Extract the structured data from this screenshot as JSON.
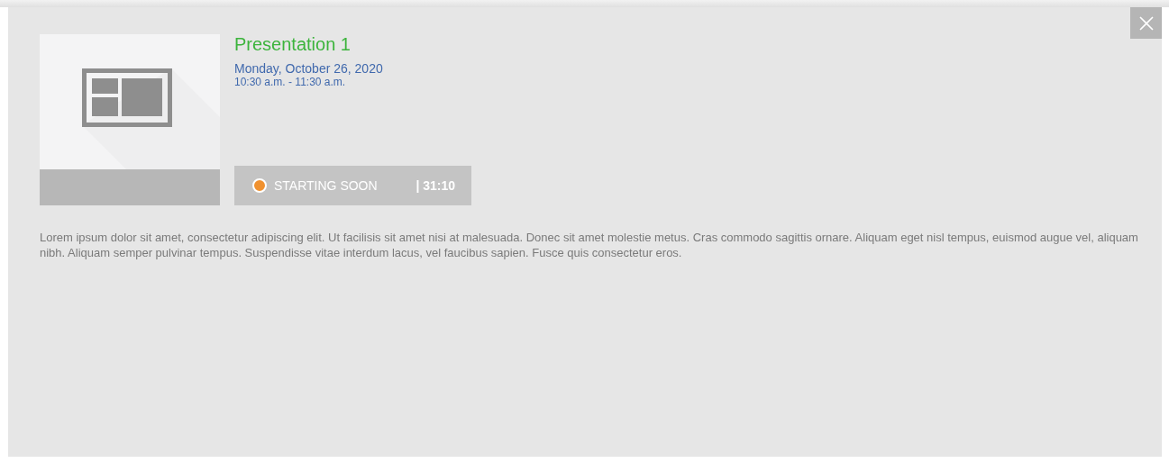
{
  "event": {
    "title": "Presentation 1",
    "date": "Monday, October 26, 2020",
    "time": "10:30 a.m. - 11:30 a.m.",
    "status": {
      "label": "STARTING SOON",
      "countdown": "| 31:10",
      "color": "#f0912f"
    },
    "description": "Lorem ipsum dolor sit amet, consectetur adipiscing elit. Ut facilisis sit amet nisi at malesuada. Donec sit amet molestie metus. Cras commodo sagittis ornare. Aliquam eget nisl tempus, euismod augue vel, aliquam nibh. Aliquam semper pulvinar tempus. Suspendisse vitae interdum lacus, vel faucibus sapien. Fusce quis consectetur eros."
  }
}
